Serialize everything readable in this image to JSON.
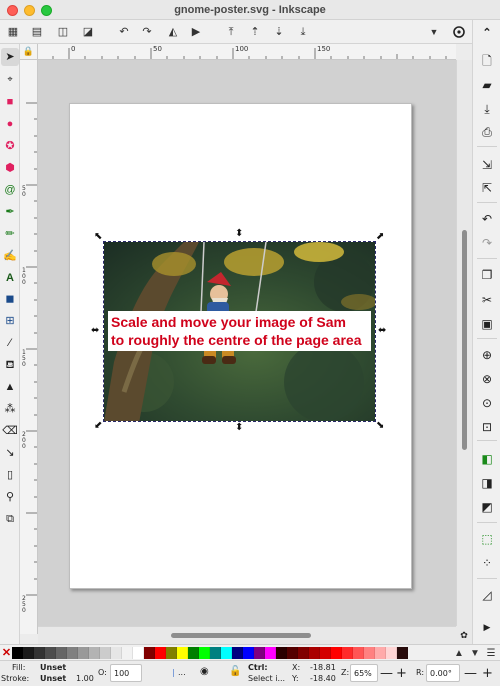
{
  "window": {
    "title": "gnome-poster.svg - Inkscape"
  },
  "command_bar": {
    "buttons": [
      {
        "name": "select-all-icon",
        "glyph": "▦"
      },
      {
        "name": "select-all-layers-icon",
        "glyph": "▤"
      },
      {
        "name": "deselect-icon",
        "glyph": "◫"
      },
      {
        "name": "select-same-icon",
        "glyph": "◪"
      },
      {
        "name": "rotate-ccw-icon",
        "glyph": "↶"
      },
      {
        "name": "rotate-cw-icon",
        "glyph": "↷"
      },
      {
        "name": "flip-horizontal-icon",
        "glyph": "◭"
      },
      {
        "name": "flip-vertical-icon",
        "glyph": "▶"
      },
      {
        "name": "raise-to-top-icon",
        "glyph": "⤒"
      },
      {
        "name": "raise-icon",
        "glyph": "⇡"
      },
      {
        "name": "lower-icon",
        "glyph": "⇣"
      },
      {
        "name": "lower-to-bottom-icon",
        "glyph": "⤓"
      }
    ],
    "more_icon": "▼"
  },
  "rulers": {
    "top_labels": [
      "0",
      "50",
      "100",
      "150"
    ],
    "left_labels": [
      "50",
      "100",
      "150",
      "200",
      "250"
    ]
  },
  "canvas": {
    "overlay_text_line1": "Scale and move your image of Sam",
    "overlay_text_line2": "to roughly the centre of the page area"
  },
  "palette": {
    "none_icon": "✕",
    "colors": [
      "#000000",
      "#1a1a1a",
      "#333333",
      "#4d4d4d",
      "#666666",
      "#808080",
      "#999999",
      "#b3b3b3",
      "#cccccc",
      "#e6e6e6",
      "#f2f2f2",
      "#ffffff",
      "#800000",
      "#ff0000",
      "#808000",
      "#ffff00",
      "#008000",
      "#00ff00",
      "#008080",
      "#00ffff",
      "#000080",
      "#0000ff",
      "#800080",
      "#ff00ff",
      "#2b0000",
      "#550000",
      "#800000",
      "#aa0000",
      "#d40000",
      "#ff0000",
      "#ff2a2a",
      "#ff5555",
      "#ff8080",
      "#ffaaaa",
      "#ffd5d5",
      "#280b0b"
    ],
    "menu_icon": "▲",
    "down_icon": "▼",
    "scroll_icon": "☰"
  },
  "status": {
    "fill_label": "Fill:",
    "fill_value": "Unset",
    "stroke_label": "Stroke:",
    "stroke_value": "Unset",
    "stroke_width": "1.00",
    "opacity_label": "O:",
    "opacity_value": "100",
    "layer_value": "...",
    "ctrl_label": "Ctrl:",
    "message": "Select i...",
    "x_label": "X:",
    "x_value": "-18.81",
    "y_label": "Y:",
    "y_value": "-18.40",
    "zoom_label": "Z:",
    "zoom_value": "65%",
    "rotation_label": "R:",
    "rotation_value": "0.00°",
    "minus": "—",
    "plus": "+"
  }
}
